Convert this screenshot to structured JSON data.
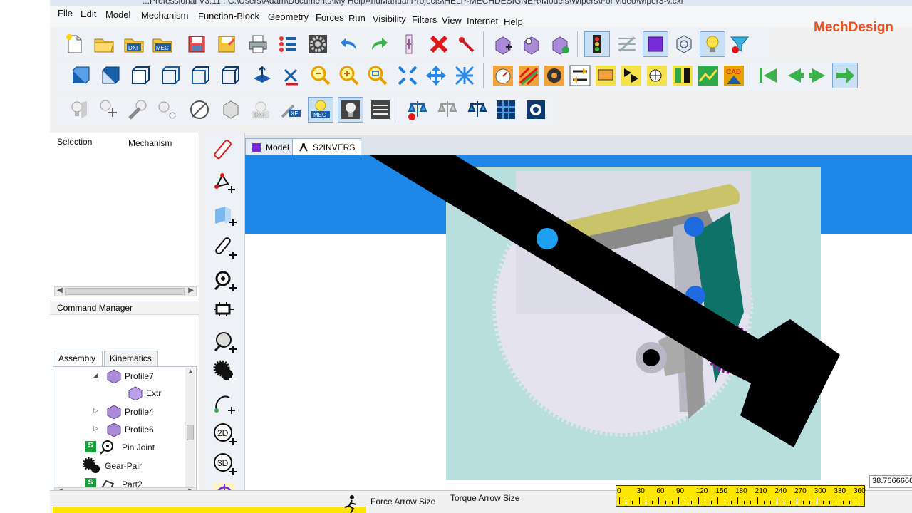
{
  "window": {
    "title": "...Professional V3.11 : C:\\Users\\Adam\\Documents\\My HelpAndManual Projects\\HELP-MECHDESIGNER\\Models\\Wipers\\For video\\wiper3-v.cxl",
    "brand": "MechDesign"
  },
  "menu": [
    "File",
    "Edit",
    "Model",
    "Mechanism",
    "Function-Block",
    "Geometry",
    "Forces",
    "Run",
    "Visibility",
    "Filters",
    "View",
    "Internet",
    "Help"
  ],
  "toolbar": {
    "row1_icons": [
      "new-file-icon",
      "open-folder-icon",
      "import-dxf-icon",
      "import-mec-icon",
      "save-icon",
      "save-as-icon",
      "print-icon",
      "list-icon",
      "settings-gear-icon",
      "undo-icon",
      "redo-icon",
      "element-list-icon",
      "delete-icon",
      "edit-pen-icon",
      "add-part-icon",
      "add-profile-icon",
      "check-icon",
      "traffic-light-icon",
      "grid-off-icon",
      "solid-cube-icon",
      "cube-outline-icon",
      "light-bulb-icon",
      "filter-icon"
    ],
    "row2_icons": [
      "view-front-icon",
      "view-top-icon",
      "view-side-icon",
      "view-iso-icon",
      "view-back-icon",
      "view-wire-icon",
      "rotate-view-icon",
      "rotate-model-icon",
      "zoom-out-icon",
      "zoom-in-icon",
      "zoom-window-icon",
      "zoom-fit-icon",
      "pan-icon",
      "fit-all-icon",
      "gauge-icon",
      "colour-function-icon",
      "cam-icon",
      "switch-icon",
      "plot-icon",
      "flags-icon",
      "graph-icon",
      "meter-icon",
      "graph-color-icon",
      "cad-icon",
      "first-step-icon",
      "previous-step-icon",
      "next-step-icon",
      "last-step-icon"
    ],
    "row3_icons": [
      "bulb-vertical-icon",
      "bulb-arrow-icon",
      "tool-icon",
      "bulb-small-icon",
      "circle-tool-icon",
      "cube-tool-icon",
      "dxf-export-icon",
      "xf-export-icon",
      "mec-export-icon",
      "bulb-dark-icon",
      "sequence-icon",
      "balance-delete-icon",
      "balance-grey-icon",
      "balance-blue-icon",
      "grid-blue-icon",
      "camera-icon"
    ]
  },
  "left_panel": {
    "tab_selection": "Selection",
    "tab_mechanism": "Mechanism",
    "command_manager": "Command Manager",
    "tab_assembly": "Assembly",
    "tab_kinematics": "Kinematics",
    "tree": [
      {
        "label": "Profile7",
        "icon": "profile-icon"
      },
      {
        "label": "Extr",
        "icon": "extrude-icon"
      },
      {
        "label": "Profile4",
        "icon": "profile-icon"
      },
      {
        "label": "Profile6",
        "icon": "profile-icon"
      },
      {
        "label": "Pin Joint",
        "icon": "pin-joint-icon"
      },
      {
        "label": "Gear-Pair",
        "icon": "gear-pair-icon"
      },
      {
        "label": "Part2",
        "icon": "part-icon"
      }
    ]
  },
  "vertical_toolbar": [
    "pencil-icon",
    "add-point-icon",
    "add-plane-icon",
    "add-link-icon",
    "add-joint-icon",
    "add-slider-icon",
    "add-circle-icon",
    "add-gear-icon",
    "add-spline-icon",
    "add-2d-icon",
    "add-3d-icon",
    "add-target-icon"
  ],
  "doc_tabs": {
    "model": "Model",
    "s2invers": "S2INVERS"
  },
  "statusbar": {
    "force_arrow_size": "Force Arrow Size",
    "torque_arrow_size": "Torque Arrow Size",
    "angle_ruler_labels": [
      "0",
      "30",
      "60",
      "90",
      "120",
      "150",
      "180",
      "210",
      "240",
      "270",
      "300",
      "330",
      "360"
    ],
    "readout": "38.7666666"
  },
  "colors": {
    "sky_blue": "#1e88e8",
    "pale_cyan": "#b8dedd",
    "gear_lavender": "#e4e3ef",
    "yellow_link": "#c9c46a",
    "grey_link": "#9a9a9a",
    "teal_link": "#0e7268",
    "wiper_black": "#000000",
    "pin_blue": "#1ea0f0",
    "accent_orange": "#e8501c",
    "ruler_yellow": "#ffe600"
  }
}
